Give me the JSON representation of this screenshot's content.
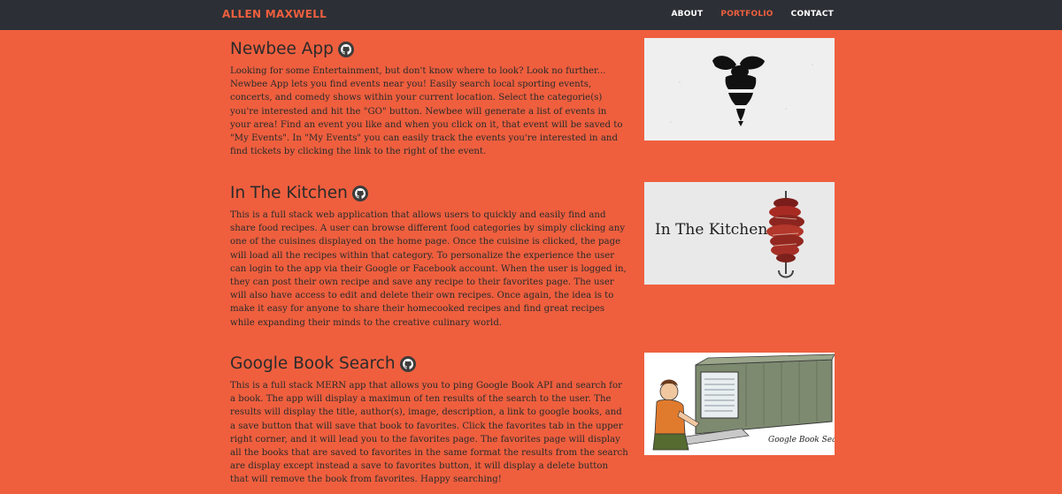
{
  "nav": {
    "brand": "ALLEN MAXWELL",
    "links": [
      {
        "label": "ABOUT"
      },
      {
        "label": "PORTFOLIO"
      },
      {
        "label": "CONTACT"
      }
    ]
  },
  "projects": [
    {
      "title": "Newbee App",
      "description": "Looking for some Entertainment, but don't know where to look? Look no further... Newbee App lets you find events near you! Easily search local sporting events, concerts, and comedy shows within your current location. Select the categorie(s) you're interested and hit the \"GO\" button. Newbee will generate a list of events in your area! Find an event you like and when you click on it, that event will be saved to \"My Events\". In \"My Events\" you can easily track the events you're interested in and find tickets by clicking the link to the right of the event.",
      "image_caption": ""
    },
    {
      "title": "In The Kitchen",
      "description": "This is a full stack web application that allows users to quickly and easily find and share food recipes. A user can browse different food categories by simply clicking any one of the cuisines displayed on the home page. Once the cuisine is clicked, the page will load all the recipes within that category. To personalize the experience the user can login to the app via their Google or Facebook account. When the user is logged in, they can post their own recipe and save any recipe to their favorites page. The user will also have access to edit and delete their own recipes. Once again, the idea is to make it easy for anyone to share their homecooked recipes and find great recipes while expanding their minds to the creative culinary world.",
      "image_caption": "In The Kitchen"
    },
    {
      "title": "Google Book Search",
      "description": "This is a full stack MERN app that allows you to ping Google Book API and search for a book. The app will display a maximun of ten results of the search to the user. The results will display the title, author(s), image, description, a link to google books, and a save button that will save that book to favorites. Click the favorites tab in the upper right corner, and it will lead you to the favorites page. The favorites page will display all the books that are saved to favorites in the same format the results from the search are display except instead a save to favorites button, it will display a delete button that will remove the book from favorites. Happy searching!",
      "image_caption": "Google Book Search"
    }
  ],
  "icons": {
    "github": "github-icon"
  }
}
